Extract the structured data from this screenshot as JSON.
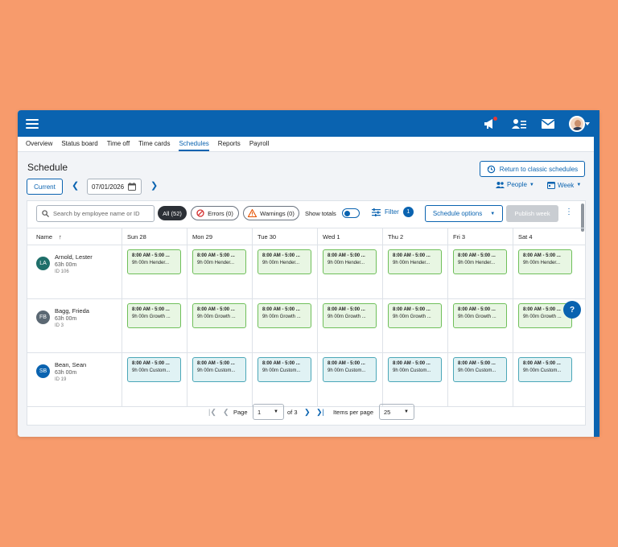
{
  "nav_tabs": [
    {
      "label": "Overview"
    },
    {
      "label": "Status board"
    },
    {
      "label": "Time off"
    },
    {
      "label": "Time cards"
    },
    {
      "label": "Schedules",
      "active": true
    },
    {
      "label": "Reports"
    },
    {
      "label": "Payroll"
    }
  ],
  "page": {
    "title": "Schedule",
    "return_label": "Return to classic schedules",
    "current_label": "Current",
    "date_value": "07/01/2026",
    "people_label": "People",
    "week_label": "Week"
  },
  "toolbar": {
    "search_placeholder": "Search by employee name or ID",
    "all_label": "All (52)",
    "errors_label": "Errors (0)",
    "warnings_label": "Warnings (0)",
    "show_totals_label": "Show totals",
    "filter_label": "Filter",
    "filter_count": "1",
    "schedule_options_label": "Schedule options",
    "publish_label": "Publish week"
  },
  "table": {
    "name_header": "Name",
    "sort_indicator": "↑",
    "days": [
      "Sun 28",
      "Mon 29",
      "Tue 30",
      "Wed 1",
      "Thu 2",
      "Fri 3",
      "Sat 4"
    ],
    "employees": [
      {
        "initials": "LA",
        "name": "Arnold, Lester",
        "hours": "63h 00m",
        "id": "ID 106",
        "avatar_color": "#1f6f6a",
        "shift_time": "8:00 AM - 5:00 ...",
        "shift_desc": "9h 00m Hender...",
        "shift_color": "green"
      },
      {
        "initials": "FB",
        "name": "Bagg, Frieda",
        "hours": "63h 00m",
        "id": "ID 3",
        "avatar_color": "#5b6873",
        "shift_time": "8:00 AM - 5:00 ...",
        "shift_desc": "9h 00m Growth ...",
        "shift_color": "green"
      },
      {
        "initials": "SB",
        "name": "Bean, Sean",
        "hours": "63h 00m",
        "id": "ID 19",
        "avatar_color": "#0a63b0",
        "shift_time": "8:00 AM - 5:00 ...",
        "shift_desc": "9h 00m Custom...",
        "shift_color": "blue"
      }
    ]
  },
  "pager": {
    "page_label": "Page",
    "page_value": "1",
    "of_label": "of 3",
    "items_per_page_label": "Items per page",
    "items_per_page_value": "25"
  },
  "help_label": "?",
  "colors": {
    "background": "#f79b6c",
    "primary": "#0a63b0",
    "shift_green_bg": "#e8f6e3",
    "shift_green_border": "#6fbf5a",
    "shift_blue_bg": "#e0f2f4",
    "shift_blue_border": "#4ba7b8"
  },
  "icons": [
    "hamburger-menu-icon",
    "megaphone-icon",
    "team-icon",
    "mail-icon",
    "user-avatar",
    "calendar-icon",
    "search-icon",
    "error-icon",
    "warning-icon",
    "filter-icon",
    "history-icon"
  ]
}
